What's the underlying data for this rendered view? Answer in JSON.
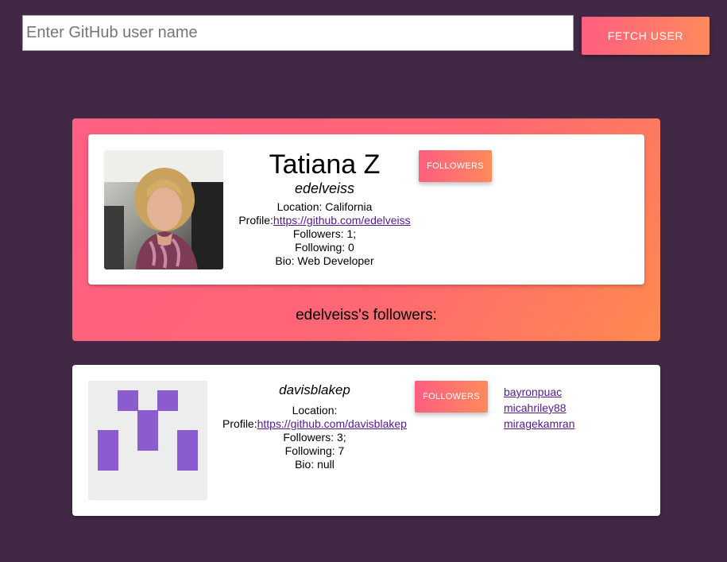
{
  "search": {
    "placeholder": "Enter GitHub user name",
    "button_label": "FETCH USER"
  },
  "user": {
    "name": "Tatiana Z",
    "login": "edelveiss",
    "location": "Location: California",
    "profile_label": "Profile:",
    "profile_url": "https://github.com/edelveiss",
    "followers": "Followers: 1;",
    "following": "Following: 0",
    "bio": "Bio: Web Developer",
    "followers_button": "FOLLOWERS",
    "followers_heading": "edelveiss's followers:"
  },
  "followers": [
    {
      "login": "davisblakep",
      "location": "Location:",
      "profile_label": "Profile:",
      "profile_url": "https://github.com/davisblakep",
      "followers": "Followers: 3;",
      "following": "Following: 7",
      "bio": "Bio: null",
      "followers_button": "FOLLOWERS",
      "follower_links": [
        "bayronpuac",
        "micahriley88",
        "miragekamran"
      ]
    }
  ],
  "colors": {
    "page_background": "#412845",
    "accent_start": "#ff5e80",
    "accent_end": "#ff8a5c",
    "identicon": "#8b5bd0",
    "link": "#551a8b"
  },
  "icons": {
    "user_avatar": "user-photo-avatar",
    "follower_avatar": "identicon-avatar"
  }
}
